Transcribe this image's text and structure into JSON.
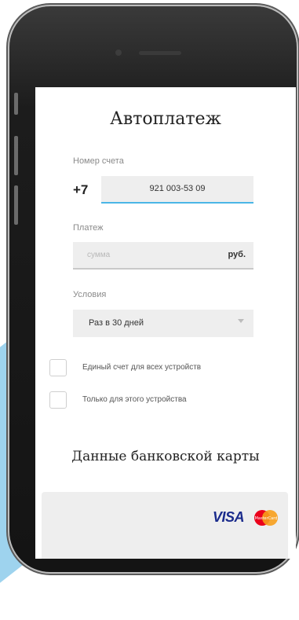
{
  "screen": {
    "title": "Автоплатеж",
    "account": {
      "label": "Номер счета",
      "prefix": "+7",
      "value": "921 003-53 09"
    },
    "payment": {
      "label": "Платеж",
      "placeholder": "сумма",
      "unit": "руб."
    },
    "conditions": {
      "label": "Условия",
      "selected": "Раз в 30 дней"
    },
    "checkboxes": [
      {
        "label": "Единый счет для всех устройств",
        "checked": false
      },
      {
        "label": "Только для этого устройства",
        "checked": false
      }
    ],
    "card_section": {
      "title": "Данные банковской карты",
      "brand_visa": "VISA",
      "brand_mastercard": "MasterCard"
    }
  },
  "icons": [
    "chevron-down-icon",
    "visa-logo-icon",
    "mastercard-logo-icon"
  ],
  "colors": {
    "accent": "#4bb6e6",
    "field_bg": "#eeeeee",
    "visa_blue": "#1a2b8c",
    "mc_red": "#eb001b",
    "mc_orange": "#f79e1b",
    "deco_blue": "#9ed3ee"
  }
}
